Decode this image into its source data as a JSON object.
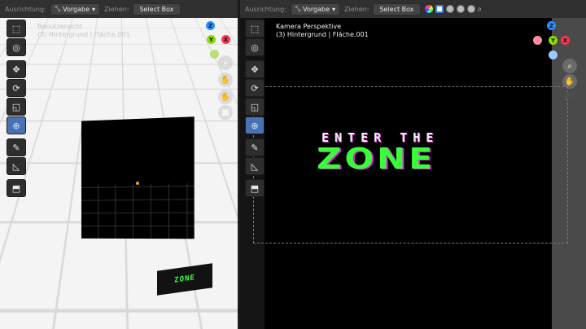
{
  "header": {
    "orientation_label": "Ausrichtung:",
    "orientation_value": "Vorgabe",
    "drag_label": "Ziehen:",
    "drag_value": "Select Box"
  },
  "left_view": {
    "title": "Benutzersicht",
    "object_info": "(3) Hintergrund | Fläche.001",
    "small_logo": "ZONE"
  },
  "right_view": {
    "title": "Kamera Perspektive",
    "object_info": "(3) Hintergrund | Fläche.001",
    "logo_top": "ENTER THE",
    "logo_bottom": "ZONE"
  },
  "gizmo": {
    "x": "X",
    "y": "Y",
    "z": "Z"
  },
  "colors": {
    "accent": "#4772b3",
    "logo_green": "#37ff37",
    "logo_pink": "#d82bd8",
    "axis_x": "#ff3352",
    "axis_y": "#8bdc00",
    "axis_z": "#2890ff"
  }
}
